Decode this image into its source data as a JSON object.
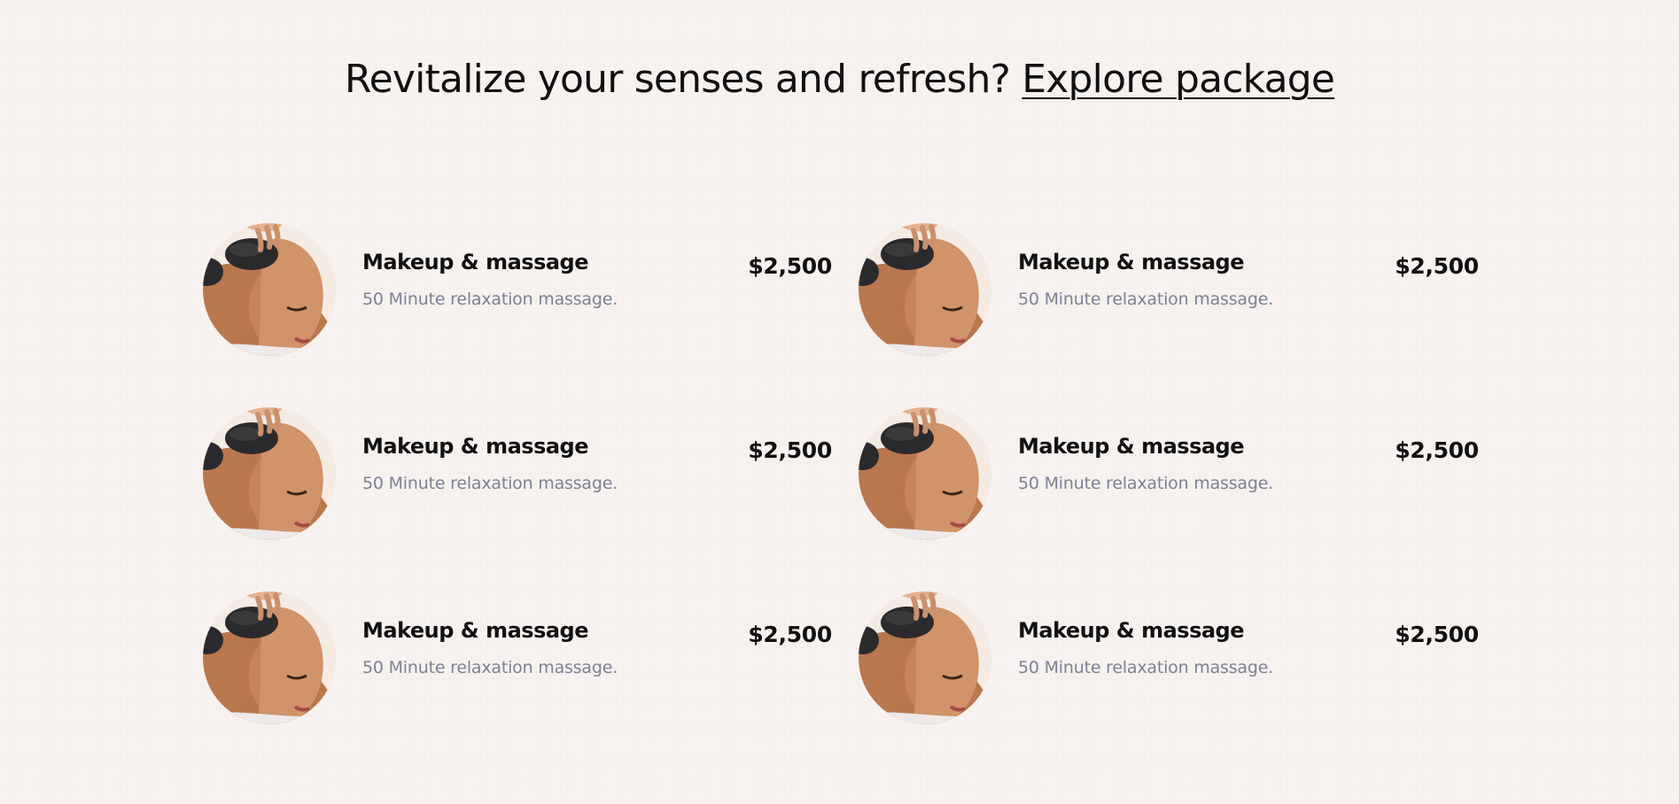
{
  "header": {
    "headline": "Revitalize your senses and refresh?",
    "link_label": "Explore package"
  },
  "packages": [
    {
      "title": "Makeup & massage",
      "description": "50 Minute relaxation massage.",
      "price": "$2,500",
      "image": "hot-stone-massage-photo"
    },
    {
      "title": "Makeup & massage",
      "description": "50 Minute relaxation massage.",
      "price": "$2,500",
      "image": "hot-stone-massage-photo"
    },
    {
      "title": "Makeup & massage",
      "description": "50 Minute relaxation massage.",
      "price": "$2,500",
      "image": "hot-stone-massage-photo"
    },
    {
      "title": "Makeup & massage",
      "description": "50 Minute relaxation massage.",
      "price": "$2,500",
      "image": "hot-stone-massage-photo"
    },
    {
      "title": "Makeup & massage",
      "description": "50 Minute relaxation massage.",
      "price": "$2,500",
      "image": "hot-stone-massage-photo"
    },
    {
      "title": "Makeup & massage",
      "description": "50 Minute relaxation massage.",
      "price": "$2,500",
      "image": "hot-stone-massage-photo"
    }
  ],
  "colors": {
    "background": "#f7f2ef",
    "text": "#111111",
    "muted_text": "#7a8294"
  }
}
